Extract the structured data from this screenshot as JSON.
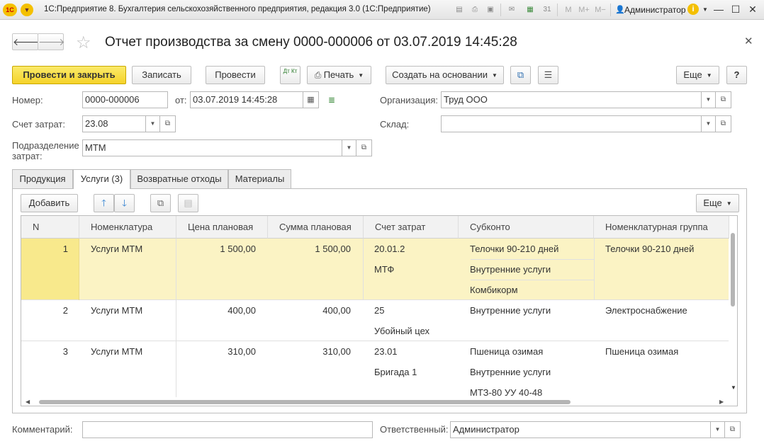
{
  "window": {
    "title": "1С:Предприятие 8. Бухгалтерия сельскохозяйственного предприятия, редакция 3.0  (1С:Предприятие)",
    "user": "Администратор",
    "memory_labels": [
      "M",
      "M+",
      "M−"
    ]
  },
  "document": {
    "title": "Отчет производства за смену 0000-000006 от 03.07.2019 14:45:28"
  },
  "toolbar": {
    "post_close": "Провести и закрыть",
    "save": "Записать",
    "post": "Провести",
    "dtkt": "Дт Кт",
    "print": "Печать",
    "create_based": "Создать на основании",
    "more": "Еще",
    "help": "?"
  },
  "form": {
    "number_label": "Номер:",
    "number_value": "0000-000006",
    "date_label": "от:",
    "date_value": "03.07.2019 14:45:28",
    "org_label": "Организация:",
    "org_value": "Труд ООО",
    "account_label": "Счет затрат:",
    "account_value": "23.08",
    "warehouse_label": "Склад:",
    "warehouse_value": "",
    "division_label_1": "Подразделение",
    "division_label_2": "затрат:",
    "division_value": "МТМ"
  },
  "tabs": [
    {
      "label": "Продукция"
    },
    {
      "label": "Услуги (3)"
    },
    {
      "label": "Возвратные отходы"
    },
    {
      "label": "Материалы"
    }
  ],
  "table_toolbar": {
    "add": "Добавить",
    "more": "Еще"
  },
  "table": {
    "columns": [
      "N",
      "Номенклатура",
      "Цена плановая",
      "Сумма плановая",
      "Счет затрат",
      "Субконто",
      "Номенклатурная группа"
    ],
    "rows": [
      {
        "n": "1",
        "item": "Услуги МТМ",
        "price": "1 500,00",
        "sum": "1 500,00",
        "account": [
          "20.01.2",
          "МТФ"
        ],
        "subconto": [
          "Телочки 90-210 дней",
          "Внутренние услуги",
          "Комбикорм"
        ],
        "group": "Телочки 90-210 дней"
      },
      {
        "n": "2",
        "item": "Услуги МТМ",
        "price": "400,00",
        "sum": "400,00",
        "account": [
          "25",
          "Убойный цех"
        ],
        "subconto": [
          "Внутренние услуги"
        ],
        "group": "Электроснабжение"
      },
      {
        "n": "3",
        "item": "Услуги МТМ",
        "price": "310,00",
        "sum": "310,00",
        "account": [
          "23.01",
          "Бригада 1"
        ],
        "subconto": [
          "Пшеница озимая",
          "Внутренние услуги",
          "МТЗ-80 УУ 40-48"
        ],
        "group": "Пшеница озимая"
      }
    ]
  },
  "footer": {
    "comment_label": "Комментарий:",
    "comment_value": "",
    "responsible_label": "Ответственный:",
    "responsible_value": "Администратор"
  },
  "colors": {
    "primary_button": "#f5d32a",
    "selected_row": "#fbf3c4",
    "selected_n_cell": "#f8e98c"
  }
}
